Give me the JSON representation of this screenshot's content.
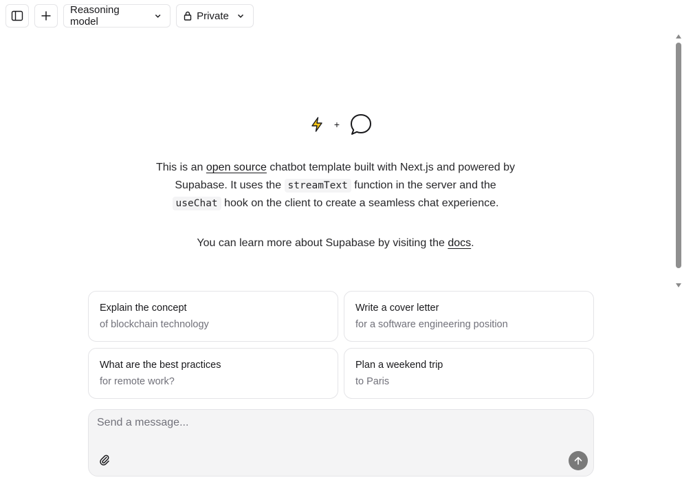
{
  "header": {
    "sidebar_toggle_icon": "sidebar-icon",
    "new_chat_icon": "plus-icon",
    "model_selector": {
      "label": "Reasoning model",
      "icon": "chevron-down-icon"
    },
    "visibility_selector": {
      "label": "Private",
      "leading_icon": "lock-icon",
      "icon": "chevron-down-icon"
    }
  },
  "hero": {
    "icons": [
      "bolt-icon",
      "message-circle-icon"
    ],
    "plus_glyph": "+",
    "bolt_color": "#f5c518"
  },
  "intro": {
    "p1_part1": "This is an ",
    "p1_link": "open source",
    "p1_part2": " chatbot template built with Next.js and powered by Supabase. It uses the ",
    "p1_code1": "streamText",
    "p1_part3": " function in the server and the ",
    "p1_code2": "useChat",
    "p1_part4": " hook on the client to create a seamless chat experience.",
    "p2_part1": "You can learn more about Supabase by visiting the ",
    "p2_link": "docs",
    "p2_part2": "."
  },
  "suggestions": [
    {
      "title": "Explain the concept",
      "subtitle": "of blockchain technology"
    },
    {
      "title": "Write a cover letter",
      "subtitle": "for a software engineering position"
    },
    {
      "title": "What are the best practices",
      "subtitle": "for remote work?"
    },
    {
      "title": "Plan a weekend trip",
      "subtitle": "to Paris"
    }
  ],
  "composer": {
    "placeholder": "Send a message...",
    "value": "",
    "attach_icon": "paperclip-icon",
    "send_icon": "arrow-up-icon"
  },
  "colors": {
    "accent_text": "#18181b",
    "muted_text": "#71717a",
    "border": "#e4e4e7",
    "composer_bg": "#f4f4f5",
    "send_button": "#7a7a7a"
  }
}
